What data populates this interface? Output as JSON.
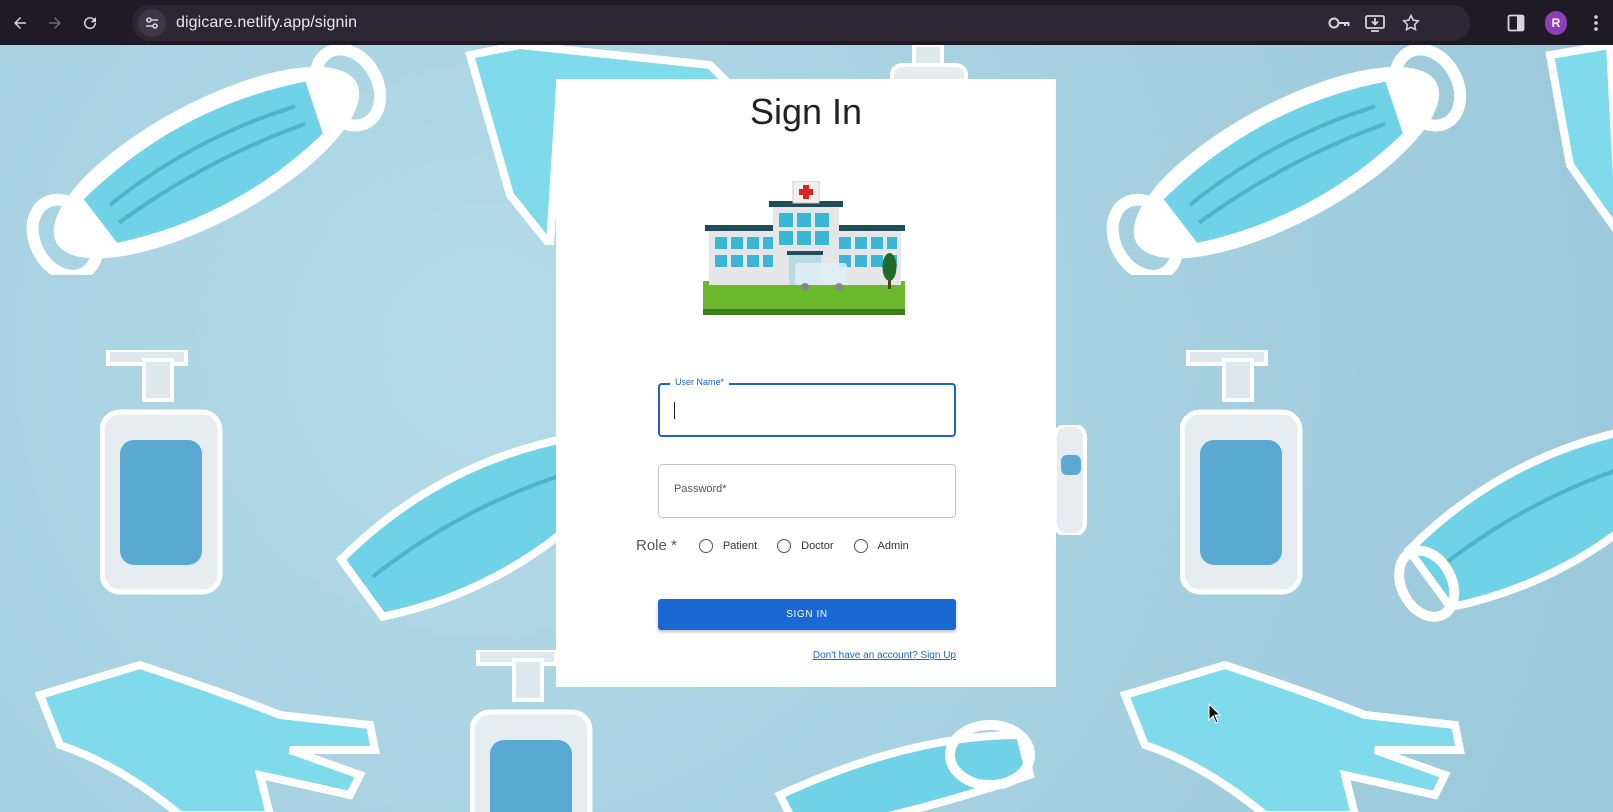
{
  "browser": {
    "url": "digicare.netlify.app/signin",
    "profile_initial": "R"
  },
  "page": {
    "title": "Sign In",
    "username_label": "User Name",
    "username_required_mark": "*",
    "password_placeholder": "Password",
    "password_required_mark": "*",
    "role_label": "Role",
    "role_required_mark": "*",
    "role_options": [
      "Patient",
      "Doctor",
      "Admin"
    ],
    "submit_label": "SIGN IN",
    "signup_link": "Don't have an account? Sign Up"
  },
  "colors": {
    "primary": "#1a68d1",
    "chrome": "#1f1b24",
    "background": "#a8d3e2"
  }
}
